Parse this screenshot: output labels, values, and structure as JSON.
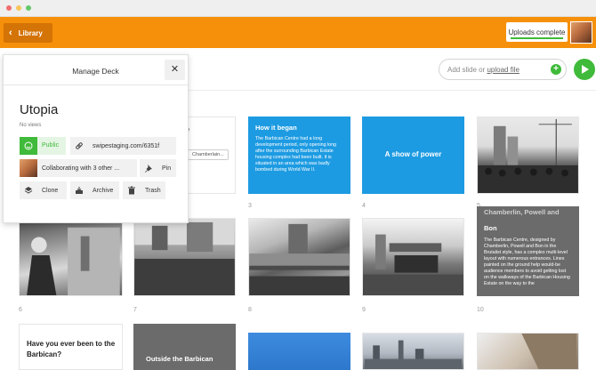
{
  "app": {
    "library_label": "Library",
    "uploads_status": "Uploads complete"
  },
  "toolbar": {
    "add_slide_prefix": "Add slide or",
    "upload_link": "upload file"
  },
  "manage_deck": {
    "title": "Manage Deck",
    "close_icon": "✕",
    "deck_name": "Utopia",
    "views": "No views",
    "public_label": "Public",
    "share_link": "swipestaging.com/6351f",
    "collab_label": "Collaborating with 3 other ...",
    "pin_label": "Pin",
    "clone_label": "Clone",
    "archive_label": "Archive",
    "trash_label": "Trash"
  },
  "slides": {
    "s2": {
      "partial_heading": "the",
      "chip": "Chamberlain..."
    },
    "s3": {
      "number": "3",
      "heading": "How it began",
      "body": "The Barbican Centre had a long development period, only opening long after the surrounding Barbican Estate housing complex had been built. It is situated in an area which was badly bombed during World War II."
    },
    "s4": {
      "number": "4",
      "heading": "A show of power"
    },
    "s5": {
      "number": "5"
    },
    "s6": {
      "number": "6"
    },
    "s7": {
      "number": "7"
    },
    "s8": {
      "number": "8"
    },
    "s9": {
      "number": "9"
    },
    "s10": {
      "number": "10",
      "heading_top": "Chamberlin, Powell and",
      "heading": "Bon",
      "body": "The Barbican Centre, designed by Chamberlin, Powell and Bon in the Brutalist style, has a complex multi-level layout with numerous entrances. Lines painted on the ground help would-be audience members to avoid getting lost on the walkways of the Barbican Housing Estate on the way to the"
    },
    "s11": {
      "heading_line1": "Have you ever been to the",
      "heading_line2": "Barbican?"
    },
    "s12": {
      "heading": "Outside the Barbican"
    }
  },
  "colors": {
    "brand_orange": "#f6900a",
    "accent_green": "#3fba3a",
    "slide_blue": "#1d9be2",
    "slide_grey": "#6b6b6b"
  },
  "icons": {
    "library_back": "chevron-left-icon",
    "add": "plus-icon",
    "play": "play-icon",
    "public": "globe-icon",
    "link": "link-icon",
    "pin": "pin-icon",
    "clone": "layers-icon",
    "archive": "archive-icon",
    "trash": "trash-icon"
  }
}
